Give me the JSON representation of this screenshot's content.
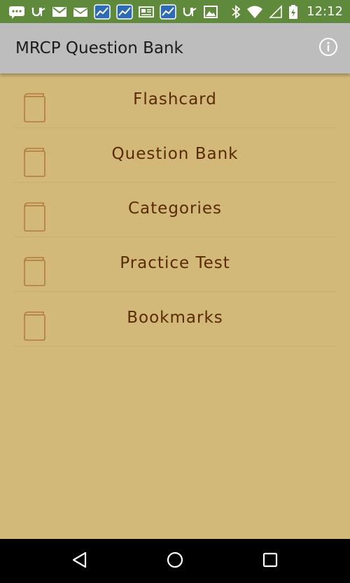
{
  "status_bar": {
    "time": "12:12",
    "left_icons": [
      "chat-icon",
      "usb-icon",
      "gmail-icon",
      "mail-icon",
      "stock-app-icon",
      "stock-app-icon",
      "news-icon",
      "stock-app-icon",
      "usb-icon",
      "image-icon"
    ],
    "right_icons": [
      "bluetooth-icon",
      "wifi-icon",
      "cellular-signal-icon",
      "battery-charging-icon"
    ],
    "background_color": "#5f8a3c"
  },
  "app_bar": {
    "title": "MRCP Question Bank",
    "info_icon": "info-icon",
    "background_color": "#bdbdbd"
  },
  "menu": {
    "items": [
      {
        "label": "Flashcard",
        "icon": "book-icon"
      },
      {
        "label": "Question Bank",
        "icon": "book-icon"
      },
      {
        "label": "Categories",
        "icon": "book-icon"
      },
      {
        "label": "Practice Test",
        "icon": "book-icon"
      },
      {
        "label": "Bookmarks",
        "icon": "book-icon"
      }
    ],
    "background_color": "#d2b979",
    "text_color": "#5a2a00"
  },
  "nav_bar": {
    "buttons": [
      "back-icon",
      "home-icon",
      "recents-icon"
    ]
  }
}
